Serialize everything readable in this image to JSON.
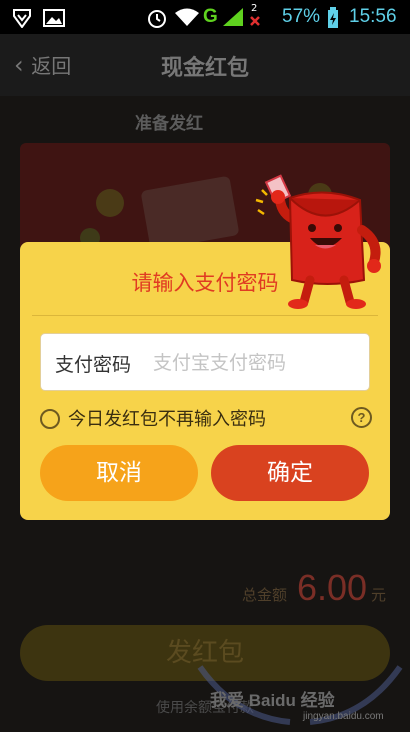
{
  "status_bar": {
    "g_label": "G",
    "battery": "57%",
    "time": "15:56",
    "sim_slot": "2"
  },
  "nav": {
    "back_label": "返回",
    "title": "现金红包"
  },
  "background": {
    "prepare_label": "准备发红",
    "total_label": "总金额",
    "total_amount": "6.00",
    "total_unit": "元",
    "send_button": "发红包",
    "balance_note": "使用余额宝付款",
    "watermark": "我爱 Baidu 经验",
    "watermark_url": "jingyan.baidu.com"
  },
  "dialog": {
    "title": "请输入支付密码",
    "password_label": "支付密码",
    "password_placeholder": "支付宝支付密码",
    "password_value": "",
    "remember_label": "今日发红包不再输入密码",
    "remember_checked": false,
    "help_icon": "question-circle-icon",
    "cancel_label": "取消",
    "confirm_label": "确定"
  },
  "colors": {
    "dialog_bg": "#f7d34a",
    "title": "#e03b22",
    "cancel": "#f6a31a",
    "confirm": "#d9421f"
  }
}
